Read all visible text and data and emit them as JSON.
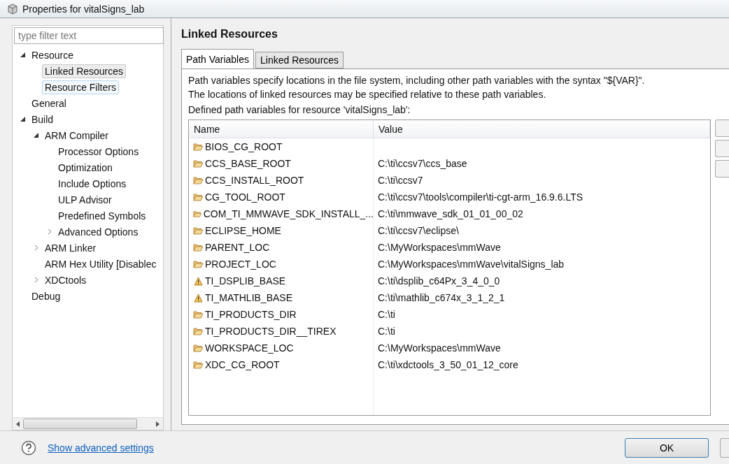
{
  "window": {
    "title": "Properties for vitalSigns_lab"
  },
  "sidebar": {
    "filter": {
      "placeholder": "type filter text"
    },
    "tree": [
      {
        "label": "Resource",
        "expanded": true,
        "selected": false,
        "hovered": false,
        "children": [
          {
            "label": "Linked Resources",
            "selected": true,
            "hovered": false
          },
          {
            "label": "Resource Filters",
            "selected": false,
            "hovered": true
          }
        ]
      },
      {
        "label": "General",
        "selected": false,
        "hovered": false
      },
      {
        "label": "Build",
        "expanded": true,
        "selected": false,
        "hovered": false,
        "children": [
          {
            "label": "ARM Compiler",
            "expanded": true,
            "selected": false,
            "hovered": false,
            "children": [
              {
                "label": "Processor Options",
                "selected": false,
                "hovered": false
              },
              {
                "label": "Optimization",
                "selected": false,
                "hovered": false
              },
              {
                "label": "Include Options",
                "selected": false,
                "hovered": false
              },
              {
                "label": "ULP Advisor",
                "selected": false,
                "hovered": false
              },
              {
                "label": "Predefined Symbols",
                "selected": false,
                "hovered": false
              },
              {
                "label": "Advanced Options",
                "expanded": false,
                "selected": false,
                "hovered": false
              }
            ]
          },
          {
            "label": "ARM Linker",
            "expanded": false,
            "selected": false,
            "hovered": false
          },
          {
            "label": "ARM Hex Utility  [Disablec",
            "selected": false,
            "hovered": false
          },
          {
            "label": "XDCtools",
            "expanded": false,
            "selected": false,
            "hovered": false
          }
        ]
      },
      {
        "label": "Debug",
        "selected": false,
        "hovered": false
      }
    ]
  },
  "page": {
    "title": "Linked Resources",
    "tabs": [
      {
        "label": "Path Variables",
        "selected": true
      },
      {
        "label": "Linked Resources",
        "selected": false
      }
    ],
    "description": [
      "Path variables specify locations in the file system, including other path variables with the syntax \"${VAR}\".",
      "The locations of linked resources may be specified relative to these path variables."
    ],
    "table_caption": "Defined path variables for resource 'vitalSigns_lab':",
    "table": {
      "columns": [
        "Name",
        "Value"
      ],
      "rows": [
        {
          "kind": "folder",
          "name": "BIOS_CG_ROOT",
          "value": ""
        },
        {
          "kind": "folder",
          "name": "CCS_BASE_ROOT",
          "value": "C:\\ti\\ccsv7\\ccs_base"
        },
        {
          "kind": "folder",
          "name": "CCS_INSTALL_ROOT",
          "value": "C:\\ti\\ccsv7"
        },
        {
          "kind": "folder",
          "name": "CG_TOOL_ROOT",
          "value": "C:\\ti\\ccsv7\\tools\\compiler\\ti-cgt-arm_16.9.6.LTS"
        },
        {
          "kind": "folder",
          "name": "COM_TI_MMWAVE_SDK_INSTALL_...",
          "value": "C:\\ti\\mmwave_sdk_01_01_00_02"
        },
        {
          "kind": "folder",
          "name": "ECLIPSE_HOME",
          "value": "C:\\ti\\ccsv7\\eclipse\\"
        },
        {
          "kind": "folder",
          "name": "PARENT_LOC",
          "value": "C:\\MyWorkspaces\\mmWave"
        },
        {
          "kind": "folder",
          "name": "PROJECT_LOC",
          "value": "C:\\MyWorkspaces\\mmWave\\vitalSigns_lab"
        },
        {
          "kind": "warning",
          "name": "TI_DSPLIB_BASE",
          "value": "C:\\ti\\dsplib_c64Px_3_4_0_0"
        },
        {
          "kind": "warning",
          "name": "TI_MATHLIB_BASE",
          "value": "C:\\ti\\mathlib_c674x_3_1_2_1"
        },
        {
          "kind": "folder",
          "name": "TI_PRODUCTS_DIR",
          "value": "C:\\ti"
        },
        {
          "kind": "folder",
          "name": "TI_PRODUCTS_DIR__TIREX",
          "value": "C:\\ti"
        },
        {
          "kind": "folder",
          "name": "WORKSPACE_LOC",
          "value": "C:\\MyWorkspaces\\mmWave"
        },
        {
          "kind": "folder",
          "name": "XDC_CG_ROOT",
          "value": "C:\\ti\\xdctools_3_50_01_12_core"
        }
      ]
    }
  },
  "footer": {
    "link": "Show advanced settings",
    "buttons": [
      "OK"
    ]
  }
}
